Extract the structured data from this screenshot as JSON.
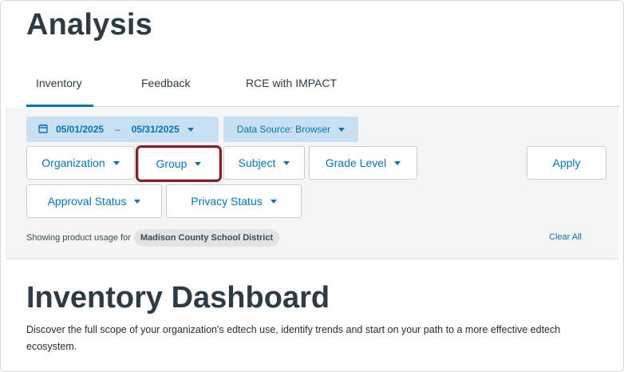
{
  "page": {
    "title": "Analysis"
  },
  "tabs": [
    {
      "label": "Inventory",
      "active": true
    },
    {
      "label": "Feedback",
      "active": false
    },
    {
      "label": "RCE with IMPACT",
      "active": false
    }
  ],
  "filters": {
    "date_start": "05/01/2025",
    "date_separator": "–",
    "date_end": "05/31/2025",
    "data_source": "Data Source: Browser",
    "organization": "Organization",
    "group": "Group",
    "subject": "Subject",
    "grade_level": "Grade Level",
    "apply": "Apply",
    "approval_status": "Approval Status",
    "privacy_status": "Privacy Status",
    "showing_text": "Showing product usage for",
    "district": "Madison County School District",
    "clear_all": "Clear All"
  },
  "dashboard": {
    "title": "Inventory Dashboard",
    "description": "Discover the full scope of your organization's edtech use, identify trends and start on your path to a more effective edtech ecosystem."
  },
  "colors": {
    "accent": "#0374b5",
    "pill_bg": "#c8e0f1",
    "highlight": "#8c1d24",
    "text": "#2d3b45"
  },
  "icons": [
    "calendar-icon",
    "caret-down-icon"
  ]
}
